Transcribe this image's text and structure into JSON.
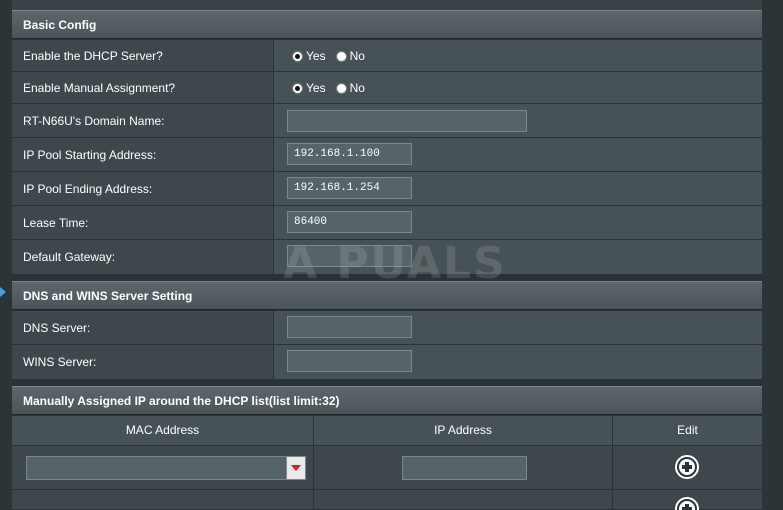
{
  "basic_config": {
    "title": "Basic Config",
    "rows": [
      {
        "label": "Enable the DHCP Server?",
        "type": "radio",
        "options": [
          "Yes",
          "No"
        ],
        "selected": "Yes"
      },
      {
        "label": "Enable Manual Assignment?",
        "type": "radio",
        "options": [
          "Yes",
          "No"
        ],
        "selected": "Yes"
      },
      {
        "label": "RT-N66U's Domain Name:",
        "type": "text",
        "value": ""
      },
      {
        "label": "IP Pool Starting Address:",
        "type": "text",
        "value": "192.168.1.100"
      },
      {
        "label": "IP Pool Ending Address:",
        "type": "text",
        "value": "192.168.1.254"
      },
      {
        "label": "Lease Time:",
        "type": "text",
        "value": "86400"
      },
      {
        "label": "Default Gateway:",
        "type": "text",
        "value": ""
      }
    ]
  },
  "dns_wins": {
    "title": "DNS and WINS Server Setting",
    "rows": [
      {
        "label": "DNS Server:",
        "value": ""
      },
      {
        "label": "WINS Server:",
        "value": ""
      }
    ]
  },
  "manual_list": {
    "title": "Manually Assigned IP around the DHCP list(list limit:32)",
    "columns": [
      "MAC Address",
      "IP Address",
      "Edit"
    ],
    "mac_value": "",
    "ip_value": ""
  },
  "watermark": "A PUALS",
  "icons": {
    "add": "plus-circle-icon",
    "dropdown": "chevron-down-icon",
    "nav": "arrow-right-icon"
  },
  "colors": {
    "header": "#535e63",
    "row_bg": "#475256",
    "label_bg": "#3e484c",
    "dropdown_arrow": "#cc2222"
  }
}
